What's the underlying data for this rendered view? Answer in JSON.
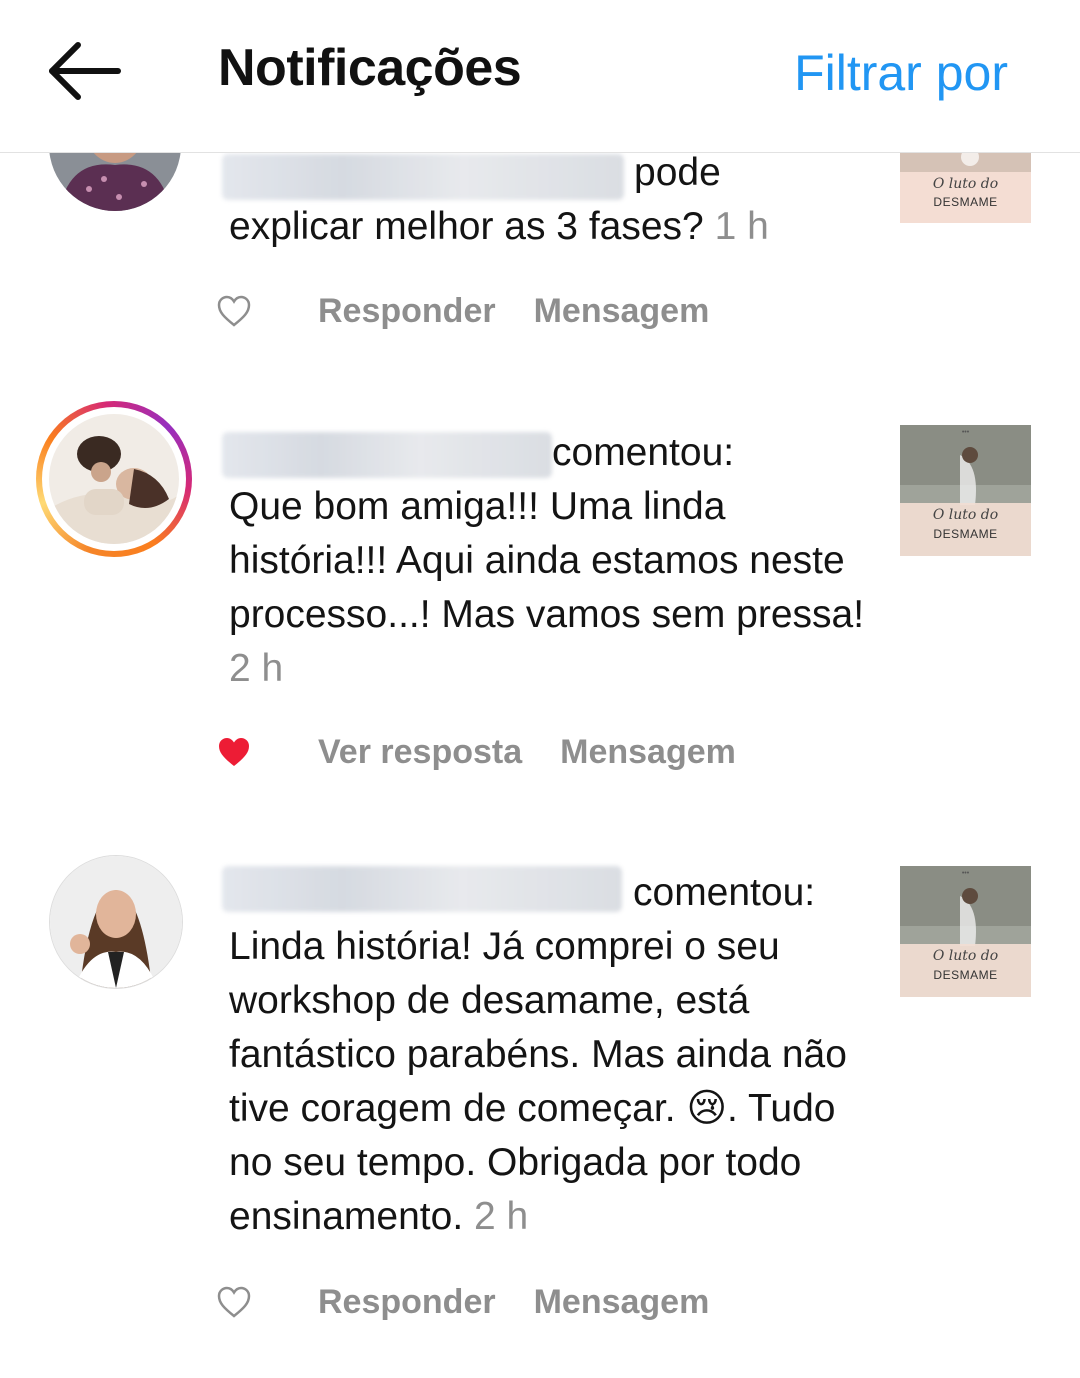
{
  "header": {
    "title": "Notificações",
    "filter_label": "Filtrar por"
  },
  "notifications": [
    {
      "suffix": "pode",
      "body": "explicar melhor as 3 fases?",
      "time": "1 h",
      "actions": [
        "Responder",
        "Mensagem"
      ],
      "liked": false,
      "thumb": {
        "title": "O luto do",
        "subtitle": "DESMAME"
      }
    },
    {
      "suffix": "comentou:",
      "body": "Que bom amiga!!! Uma linda história!!! Aqui ainda estamos neste processo...! Mas vamos sem pressa!",
      "time": "2 h",
      "actions": [
        "Ver resposta",
        "Mensagem"
      ],
      "liked": true,
      "thumb": {
        "title": "O luto do",
        "subtitle": "DESMAME"
      }
    },
    {
      "suffix": "comentou:",
      "body": "Linda história! Já comprei o seu workshop de desamame, está fantástico parabéns.  Mas ainda não tive coragem de começar. 😢. Tudo no seu tempo. Obrigada por todo ensinamento.",
      "time": "2 h",
      "actions": [
        "Responder",
        "Mensagem"
      ],
      "liked": false,
      "thumb": {
        "title": "O luto do",
        "subtitle": "DESMAME"
      }
    }
  ],
  "colors": {
    "accent": "#2196f3",
    "muted": "#8e8e8e",
    "liked_heart": "#ed1c35"
  },
  "icons": {
    "back": "arrow-left-icon",
    "like": "heart-outline-icon",
    "liked": "heart-filled-icon"
  }
}
